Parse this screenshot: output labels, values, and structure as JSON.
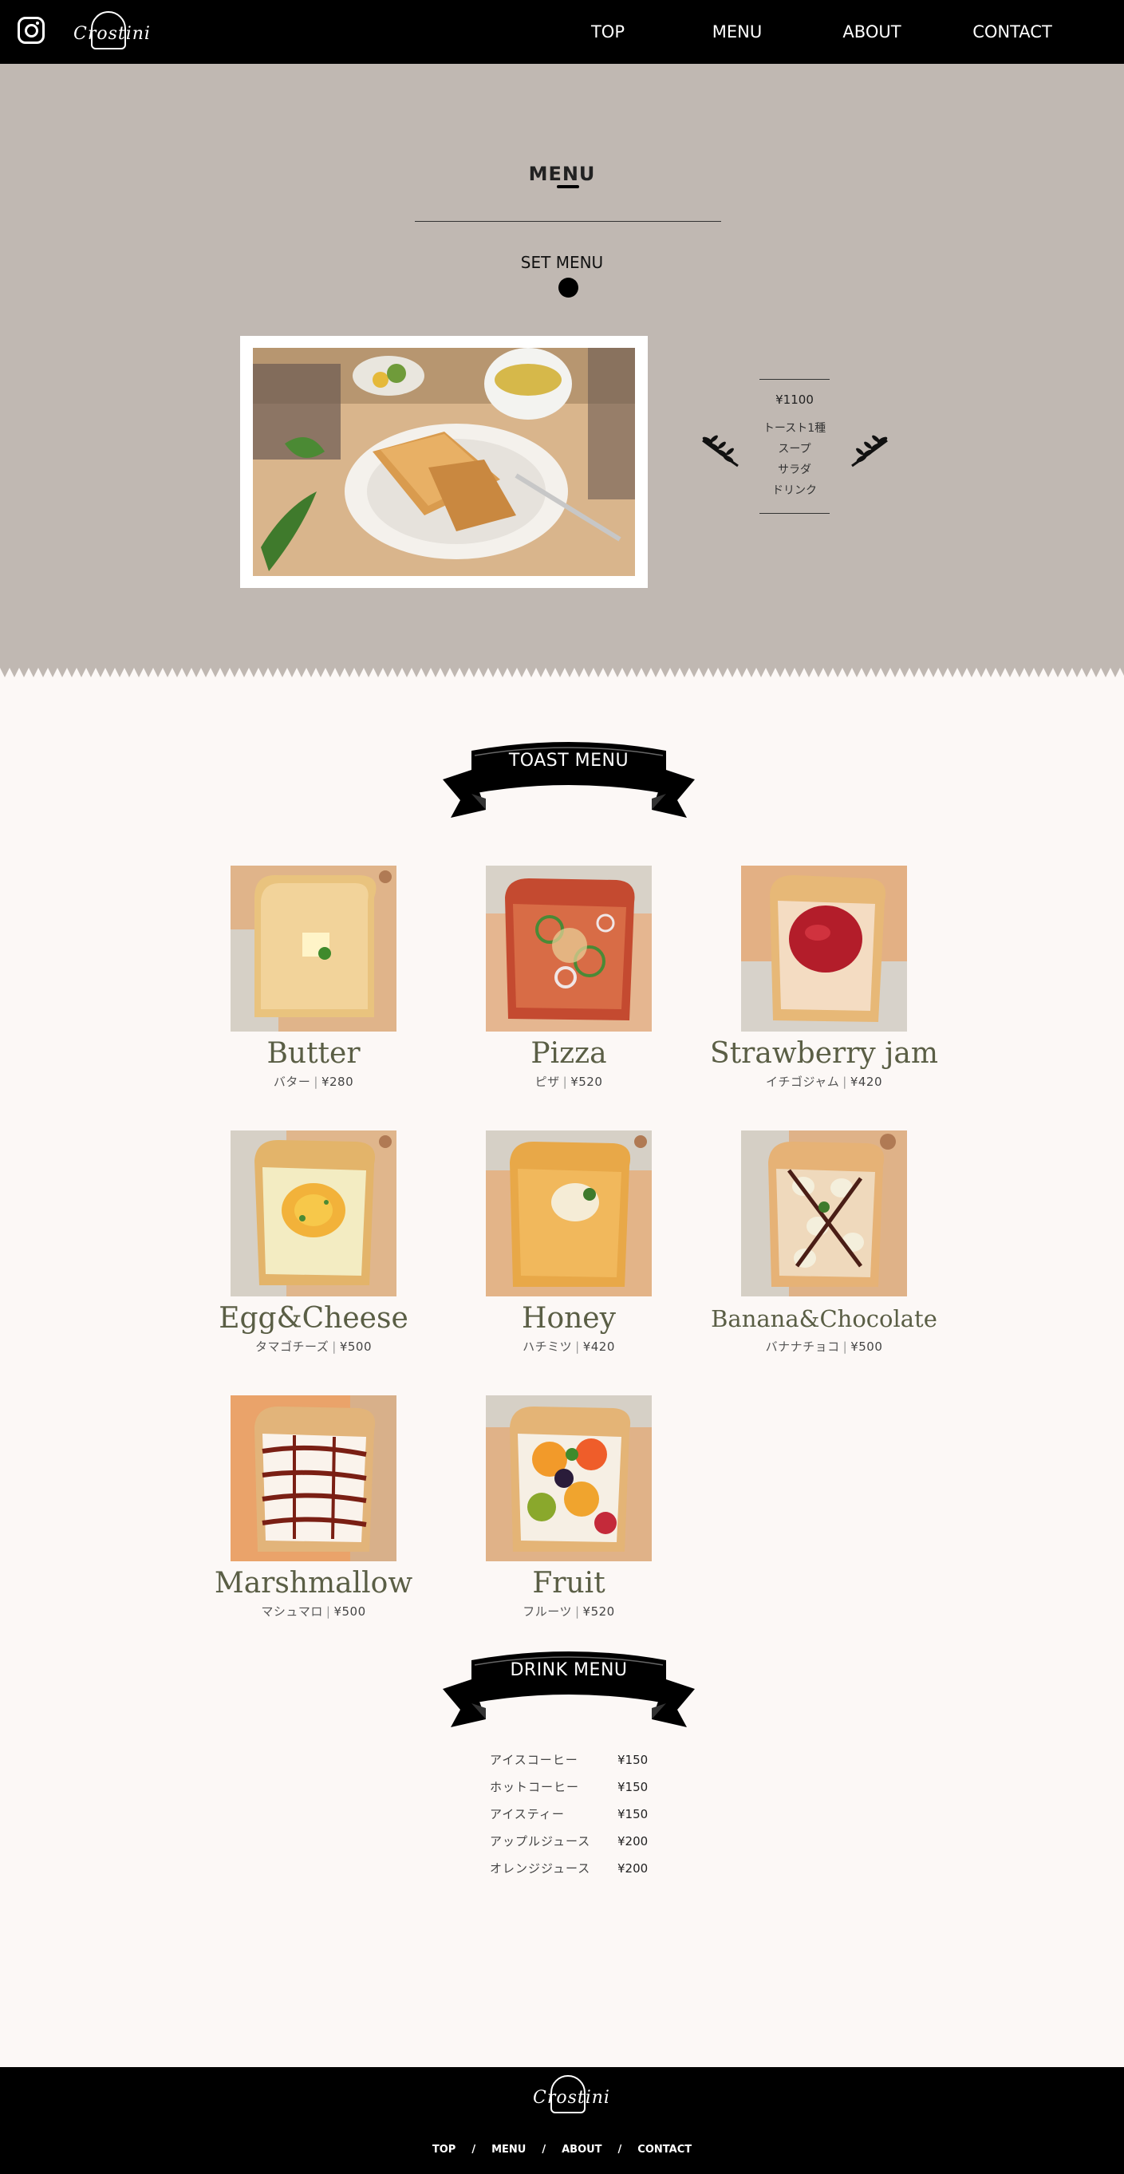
{
  "header": {
    "logo_text": "Crostini",
    "nav": [
      "TOP",
      "MENU",
      "ABOUT",
      "CONTACT"
    ]
  },
  "set_section": {
    "title": "MENU",
    "label": "SET MENU",
    "price": "¥1100",
    "items": [
      "トースト1種",
      "スープ",
      "サラダ",
      "ドリンク"
    ]
  },
  "toast_menu": {
    "banner": "TOAST MENU",
    "items": [
      {
        "name": "Butter",
        "jp": "バター",
        "price": "¥280"
      },
      {
        "name": "Pizza",
        "jp": "ピザ",
        "price": "¥520"
      },
      {
        "name": "Strawberry jam",
        "jp": "イチゴジャム",
        "price": "¥420"
      },
      {
        "name": "Egg&Cheese",
        "jp": "タマゴチーズ",
        "price": "¥500"
      },
      {
        "name": "Honey",
        "jp": "ハチミツ",
        "price": "¥420"
      },
      {
        "name": "Banana&Chocolate",
        "jp": "バナナチョコ",
        "price": "¥500"
      },
      {
        "name": "Marshmallow",
        "jp": "マシュマロ",
        "price": "¥500"
      },
      {
        "name": "Fruit",
        "jp": "フルーツ",
        "price": "¥520"
      }
    ]
  },
  "drink_menu": {
    "banner": "DRINK MENU",
    "items": [
      {
        "name": "アイスコーヒー",
        "price": "¥150"
      },
      {
        "name": "ホットコーヒー",
        "price": "¥150"
      },
      {
        "name": "アイスティー",
        "price": "¥150"
      },
      {
        "name": "アップルジュース",
        "price": "¥200"
      },
      {
        "name": "オレンジジュース",
        "price": "¥200"
      }
    ]
  },
  "footer": {
    "logo_text": "Crostini",
    "nav": [
      "TOP",
      "MENU",
      "ABOUT",
      "CONTACT"
    ],
    "separator": "/"
  },
  "colors": {
    "header_bg": "#000000",
    "set_bg": "#c0b8b2",
    "page_bg": "#fcf8f6",
    "item_name": "#5a5e45"
  }
}
